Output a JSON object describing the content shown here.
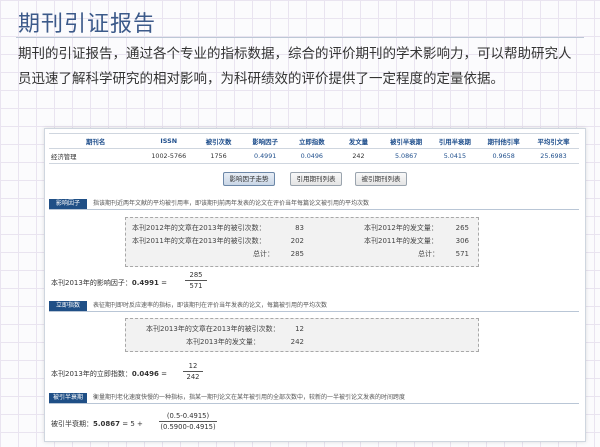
{
  "heading": {
    "title": "期刊引证报告"
  },
  "intro": {
    "text": "期刊的引证报告，通过各个专业的指标数据，综合的评价期刊的学术影响力，可以帮助研究人员迅速了解科学研究的相对影响，为科研绩效的评价提供了一定程度的定量依据。"
  },
  "report": {
    "table": {
      "headers": [
        "期刊名",
        "ISSN",
        "被引次数",
        "影响因子",
        "立即指数",
        "发文量",
        "被引半衰期",
        "引用半衰期",
        "期刊他引率",
        "平均引文率"
      ],
      "row": [
        "经济管理",
        "1002-5766",
        "1756",
        "0.4991",
        "0.0496",
        "242",
        "5.0867",
        "5.0415",
        "0.9658",
        "25.6983"
      ]
    },
    "buttons": {
      "trend": "影响因子走势",
      "citing": "引用期刊列表",
      "cited": "被引期刊列表"
    },
    "impact": {
      "tag": "影响因子",
      "desc": "指该期刊近两年文献的平均被引用率，即该期刊前两年发表的论文在评价当年每篇论文被引用的平均次数",
      "l1": "本刊2012年的文章在2013年的被引次数：",
      "v1": "83",
      "l2": "本刊2011年的文章在2013年的被引次数：",
      "v2": "202",
      "r1": "本刊2012年的发文量：",
      "rv1": "265",
      "r2": "本刊2011年的发文量：",
      "rv2": "306",
      "total_label": "总计：",
      "total_left": "285",
      "total_right": "571",
      "formula_label": "本刊2013年的影响因子：",
      "formula_value": "0.4991",
      "eq": "=",
      "num": "285",
      "den": "571"
    },
    "immediacy": {
      "tag": "立即指数",
      "desc": "表征期刊即时反应速率的指标，即该期刊在评价当年发表的论文，每篇被引用的平均次数",
      "l1": "本刊2013年的文章在2013年的被引次数：",
      "v1": "12",
      "l2": "本刊2013年的发文量：",
      "v2": "242",
      "formula_label": "本刊2013年的立即指数：",
      "formula_value": "0.0496",
      "eq": "=",
      "num": "12",
      "den": "242"
    },
    "halflife": {
      "tag": "被引半衰期",
      "desc": "衡量期刊老化速度快慢的一种指标，指某一期刊论文在某年被引用的全部次数中，较新的一半被引论文发表的时间跨度",
      "formula_label": "被引半衰期：",
      "formula_value": "5.0867",
      "eq": "= 5 +",
      "num": "(0.5-0.4915)",
      "den": "(0.5900-0.4915)"
    }
  }
}
